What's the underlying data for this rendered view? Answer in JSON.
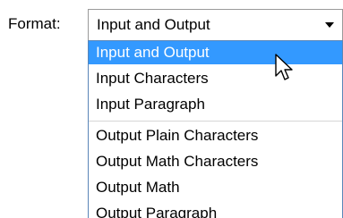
{
  "format": {
    "label": "Format:",
    "selected_value": "Input and Output",
    "options": [
      "Input and Output",
      "Input Characters",
      "Input Paragraph",
      "Output Plain Characters",
      "Output Math Characters",
      "Output Math",
      "Output Paragraph"
    ],
    "highlighted_index": 0
  },
  "icons": {
    "dropdown_arrow": "chevron-down-icon",
    "cursor": "mouse-cursor-icon"
  },
  "colors": {
    "highlight": "#3399ff",
    "highlight_text": "#ffffff",
    "list_border": "#5a86b8",
    "combo_border": "#9a9a9a"
  }
}
